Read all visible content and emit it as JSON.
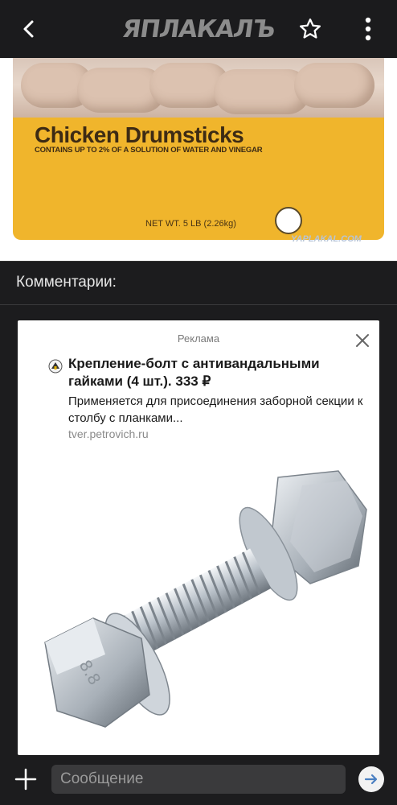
{
  "header": {
    "logo_text": "ЯПЛАКАЛЪ",
    "back_icon": "chevron-left-icon",
    "favorite_icon": "star-icon",
    "menu_icon": "more-vertical-icon"
  },
  "post_image": {
    "product_title": "Chicken Drumsticks",
    "product_subtitle": "CONTAINS UP TO 2% OF A SOLUTION OF WATER AND VINEGAR",
    "net_weight": "NET WT. 5 LB (2.26kg)",
    "watermark": "YAPLAKAL.COM"
  },
  "comments": {
    "label": "Комментарии:"
  },
  "ad": {
    "label": "Реклама",
    "title": "Крепление-болт с антивандальными гайками (4 шт.). 333 ₽",
    "description": "Применяется для присоединения заборной секции к столбу с планками...",
    "domain": "tver.petrovich.ru",
    "close_icon": "close-icon"
  },
  "composer": {
    "placeholder": "Сообщение",
    "add_icon": "plus-icon",
    "send_icon": "send-arrow-icon"
  },
  "colors": {
    "background": "#1c1c1e",
    "bag": "#f0b52c",
    "send_accent": "#4a7fc1"
  }
}
